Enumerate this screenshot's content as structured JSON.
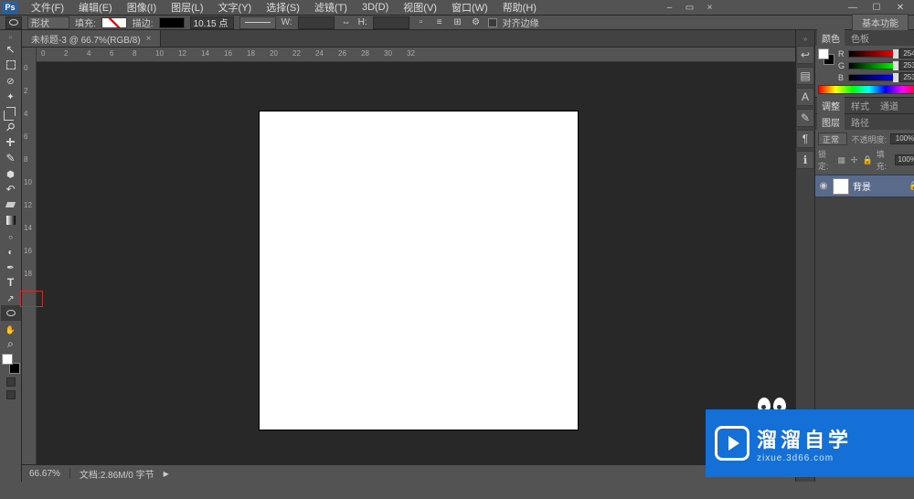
{
  "menubar": {
    "items": [
      "文件(F)",
      "编辑(E)",
      "图像(I)",
      "图层(L)",
      "文字(Y)",
      "选择(S)",
      "滤镜(T)",
      "3D(D)",
      "视图(V)",
      "窗口(W)",
      "帮助(H)"
    ]
  },
  "optionsbar": {
    "shape_mode": "形状",
    "fill_label": "填充:",
    "stroke_label": "描边:",
    "stroke_width": "10.15 点",
    "w_label": "W:",
    "h_label": "H:",
    "align_label": "对齐边缘",
    "workspace": "基本功能"
  },
  "document": {
    "tab_title": "未标题-3 @ 66.7%(RGB/8)"
  },
  "ruler_h_ticks": [
    "0",
    "2",
    "4",
    "6",
    "8",
    "10",
    "12",
    "14",
    "16",
    "18",
    "20",
    "22",
    "24",
    "26",
    "28",
    "30",
    "32"
  ],
  "ruler_v_ticks": [
    "0",
    "2",
    "4",
    "6",
    "8",
    "10",
    "12",
    "14",
    "16",
    "18"
  ],
  "statusbar": {
    "zoom": "66.67%",
    "doc_info": "文档:2.86M/0 字节"
  },
  "panels": {
    "color": {
      "tabs": [
        "颜色",
        "色板"
      ],
      "channels": [
        {
          "label": "R",
          "value": "254",
          "pct": 99.6
        },
        {
          "label": "G",
          "value": "253",
          "pct": 99.2
        },
        {
          "label": "B",
          "value": "253",
          "pct": 99.2
        }
      ]
    },
    "adjust": {
      "tabs": [
        "调整",
        "样式",
        "通道"
      ]
    },
    "layers": {
      "tabs": [
        "图层",
        "路径"
      ],
      "blend_mode": "正常",
      "opacity_label": "不透明度:",
      "opacity_value": "100%",
      "lock_label": "锁定:",
      "fill_label": "填充:",
      "fill_value": "100%",
      "items": [
        {
          "name": "背景",
          "locked": true
        }
      ]
    }
  },
  "watermark": {
    "cn": "溜溜自学",
    "en": "zixue.3d66.com"
  }
}
